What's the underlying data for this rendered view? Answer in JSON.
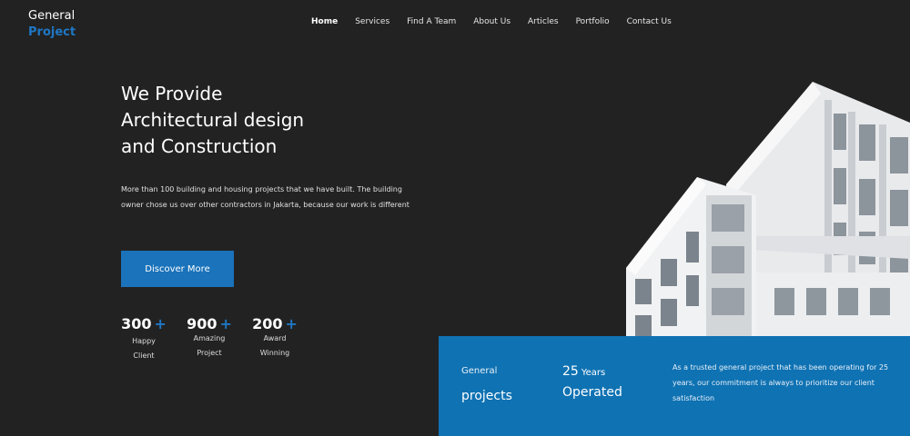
{
  "brand": {
    "line1": "General",
    "line2": "Project"
  },
  "nav": {
    "items": [
      "Home",
      "Services",
      "Find A Team",
      "About Us",
      "Articles",
      "Portfolio",
      "Contact Us"
    ]
  },
  "hero": {
    "title_line1": "We Provide",
    "title_line2": "Architectural design",
    "title_line3": "and Construction",
    "description": "More than 100 building and housing projects that we have built. The building owner chose us over other contractors in Jakarta, because our work is different",
    "cta_label": "Discover More"
  },
  "stats": [
    {
      "number": "300",
      "plus": "+",
      "label_line1": "Happy",
      "label_line2": "Client"
    },
    {
      "number": "900",
      "plus": "+",
      "label_line1": "Amazing",
      "label_line2": "Project"
    },
    {
      "number": "200",
      "plus": "+",
      "label_line1": "Award",
      "label_line2": "Winning"
    }
  ],
  "info_panel": {
    "label_small": "General",
    "label_big": "projects",
    "years_number": "25",
    "years_unit": "Years",
    "years_label": "Operated",
    "text": "As a trusted general project that has been operating for 25 years, our commitment is always to prioritize our client satisfaction"
  },
  "colors": {
    "accent": "#1a73bb",
    "background": "#222222",
    "panel": "#0f72b3"
  }
}
